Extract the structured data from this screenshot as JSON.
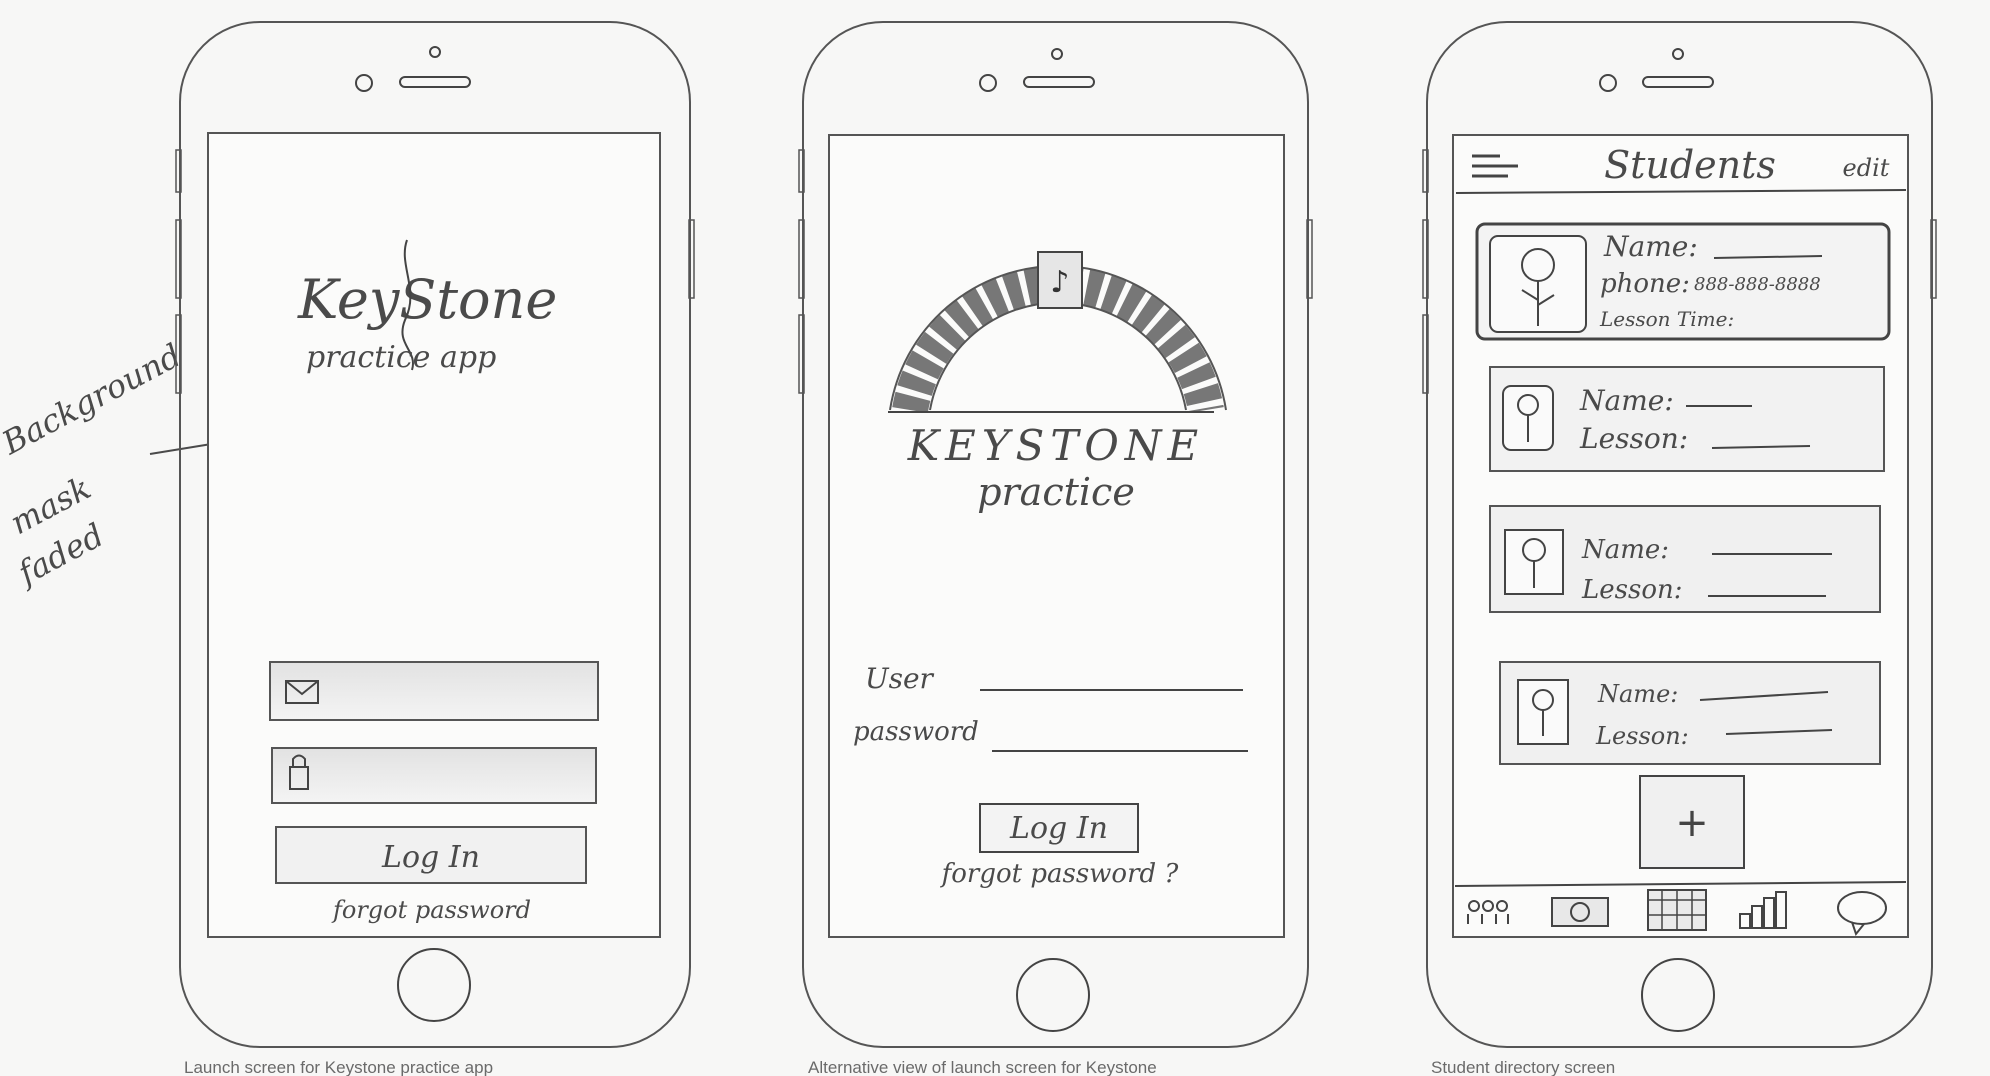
{
  "annotation": {
    "line1": "Background",
    "line2": "mask",
    "line3": "faded"
  },
  "screen1": {
    "logo": "KeyStone",
    "subtitle": "practice app",
    "email_icon": "mail-icon",
    "password_icon": "lock-icon",
    "login_label": "Log In",
    "forgot_label": "forgot password"
  },
  "screen2": {
    "logo": "KEYSTONE",
    "subtitle": "practice",
    "user_label": "User",
    "password_label": "password",
    "login_label": "Log In",
    "forgot_label": "forgot password ?"
  },
  "screen3": {
    "title": "Students",
    "edit_label": "edit",
    "menu_icon": "hamburger-menu-icon",
    "cards": [
      {
        "name_label": "Name:",
        "phone_label": "phone:",
        "phone_value": "888-888-8888",
        "lesson_label": "Lesson Time:"
      },
      {
        "name_label": "Name:",
        "lesson_label": "Lesson:"
      },
      {
        "name_label": "Name:",
        "lesson_label": "Lesson:"
      },
      {
        "name_label": "Name:",
        "lesson_label": "Lesson:"
      }
    ],
    "add_label": "+",
    "tab_icons": [
      "students-tab-icon",
      "money-tab-icon",
      "calendar-tab-icon",
      "chart-tab-icon",
      "chat-tab-icon"
    ]
  },
  "captions": {
    "c1": "Launch screen for Keystone practice app",
    "c2": "Alternative view of launch screen for Keystone",
    "c3": "Student directory screen"
  }
}
